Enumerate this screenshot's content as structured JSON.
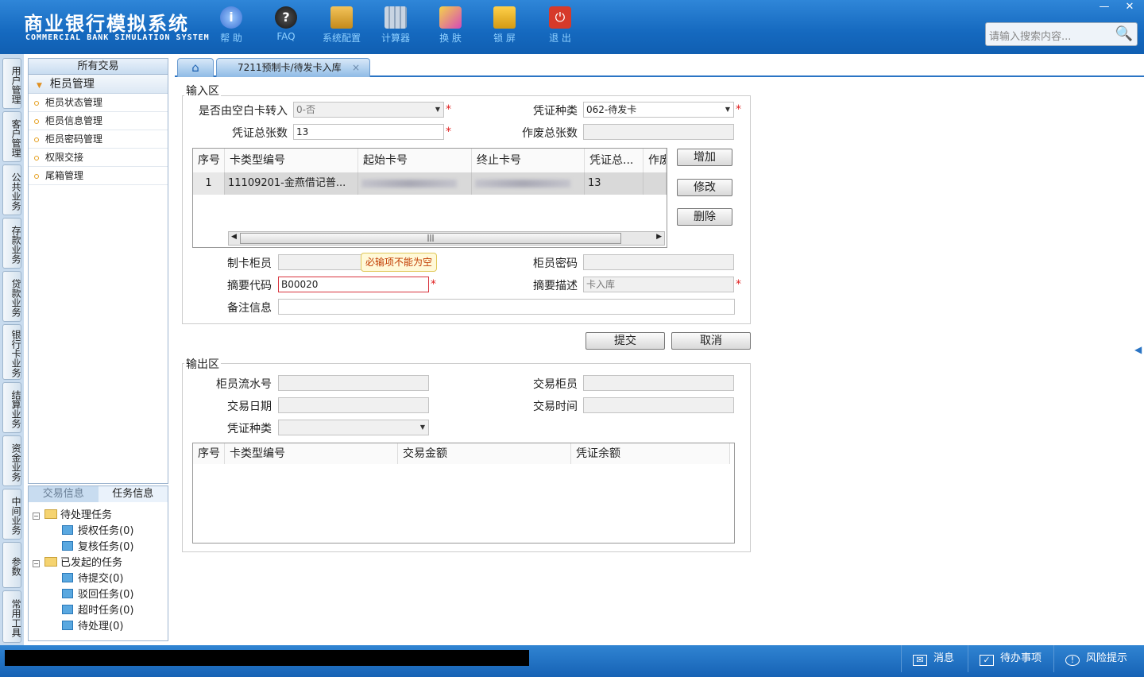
{
  "app": {
    "title": "商业银行模拟系统",
    "subtitle": "COMMERCIAL BANK SIMULATION SYSTEM"
  },
  "toolbar": [
    {
      "label": "帮 助",
      "icon": "info-icon"
    },
    {
      "label": "FAQ",
      "icon": "question-icon"
    },
    {
      "label": "系统配置",
      "icon": "toolbox-icon"
    },
    {
      "label": "计算器",
      "icon": "calculator-icon"
    },
    {
      "label": "换 肤",
      "icon": "shirt-icon"
    },
    {
      "label": "锁 屏",
      "icon": "lock-icon"
    },
    {
      "label": "退 出",
      "icon": "power-icon"
    }
  ],
  "search": {
    "placeholder": "请输入搜索内容..."
  },
  "window_controls": {
    "minimize": "—",
    "close": "✕"
  },
  "left_tabs": [
    "用户管理",
    "客户管理",
    "公共业务",
    "存款业务",
    "贷款业务",
    "银行卡业务",
    "结算业务",
    "资金业务",
    "中间业务",
    "参数",
    "常用工具"
  ],
  "sidebar": {
    "header": "所有交易",
    "group": "柜员管理",
    "items": [
      "柜员状态管理",
      "柜员信息管理",
      "柜员密码管理",
      "权限交接",
      "尾箱管理"
    ]
  },
  "task_panel": {
    "tabs": [
      "交易信息",
      "任务信息"
    ],
    "pending": "待处理任务",
    "auth": "授权任务(0)",
    "review": "复核任务(0)",
    "initiated": "已发起的任务",
    "to_submit": "待提交(0)",
    "rejected": "驳回任务(0)",
    "timeout": "超时任务(0)",
    "to_process": "待处理(0)"
  },
  "tabs": {
    "home_icon": "home-icon",
    "active": "7211预制卡/待发卡入库",
    "close": "×"
  },
  "input": {
    "legend": "输入区",
    "blank_card_label": "是否由空白卡转入",
    "blank_card_value": "0-否",
    "voucher_type_label": "凭证种类",
    "voucher_type_value": "062-待发卡",
    "total_label": "凭证总张数",
    "total_value": "13",
    "void_label": "作废总张数",
    "void_value": "",
    "grid_headers": [
      "序号",
      "卡类型编号",
      "起始卡号",
      "终止卡号",
      "凭证总...",
      "作废"
    ],
    "grid_row": {
      "no": "1",
      "card_type": "11109201-金燕借记普...",
      "start": "",
      "end": "",
      "total": "13"
    },
    "btn_add": "增加",
    "btn_edit": "修改",
    "btn_delete": "删除",
    "maker_label": "制卡柜员",
    "maker_value": "",
    "password_label": "柜员密码",
    "password_value": "",
    "summary_code_label": "摘要代码",
    "summary_code_value": "B00020",
    "summary_desc_label": "摘要描述",
    "summary_desc_value": "卡入库",
    "remark_label": "备注信息",
    "remark_value": "",
    "tooltip": "必输项不能为空"
  },
  "actions": {
    "submit": "提交",
    "cancel": "取消"
  },
  "output": {
    "legend": "输出区",
    "serial_label": "柜员流水号",
    "teller_label": "交易柜员",
    "date_label": "交易日期",
    "time_label": "交易时间",
    "voucher_label": "凭证种类",
    "grid_headers": [
      "序号",
      "卡类型编号",
      "交易金额",
      "凭证余额"
    ]
  },
  "status": {
    "message": "消息",
    "todo": "待办事项",
    "risk": "风险提示"
  },
  "colors": {
    "header": "#1569bf",
    "accent": "#2a74c4",
    "required": "#e02020"
  }
}
